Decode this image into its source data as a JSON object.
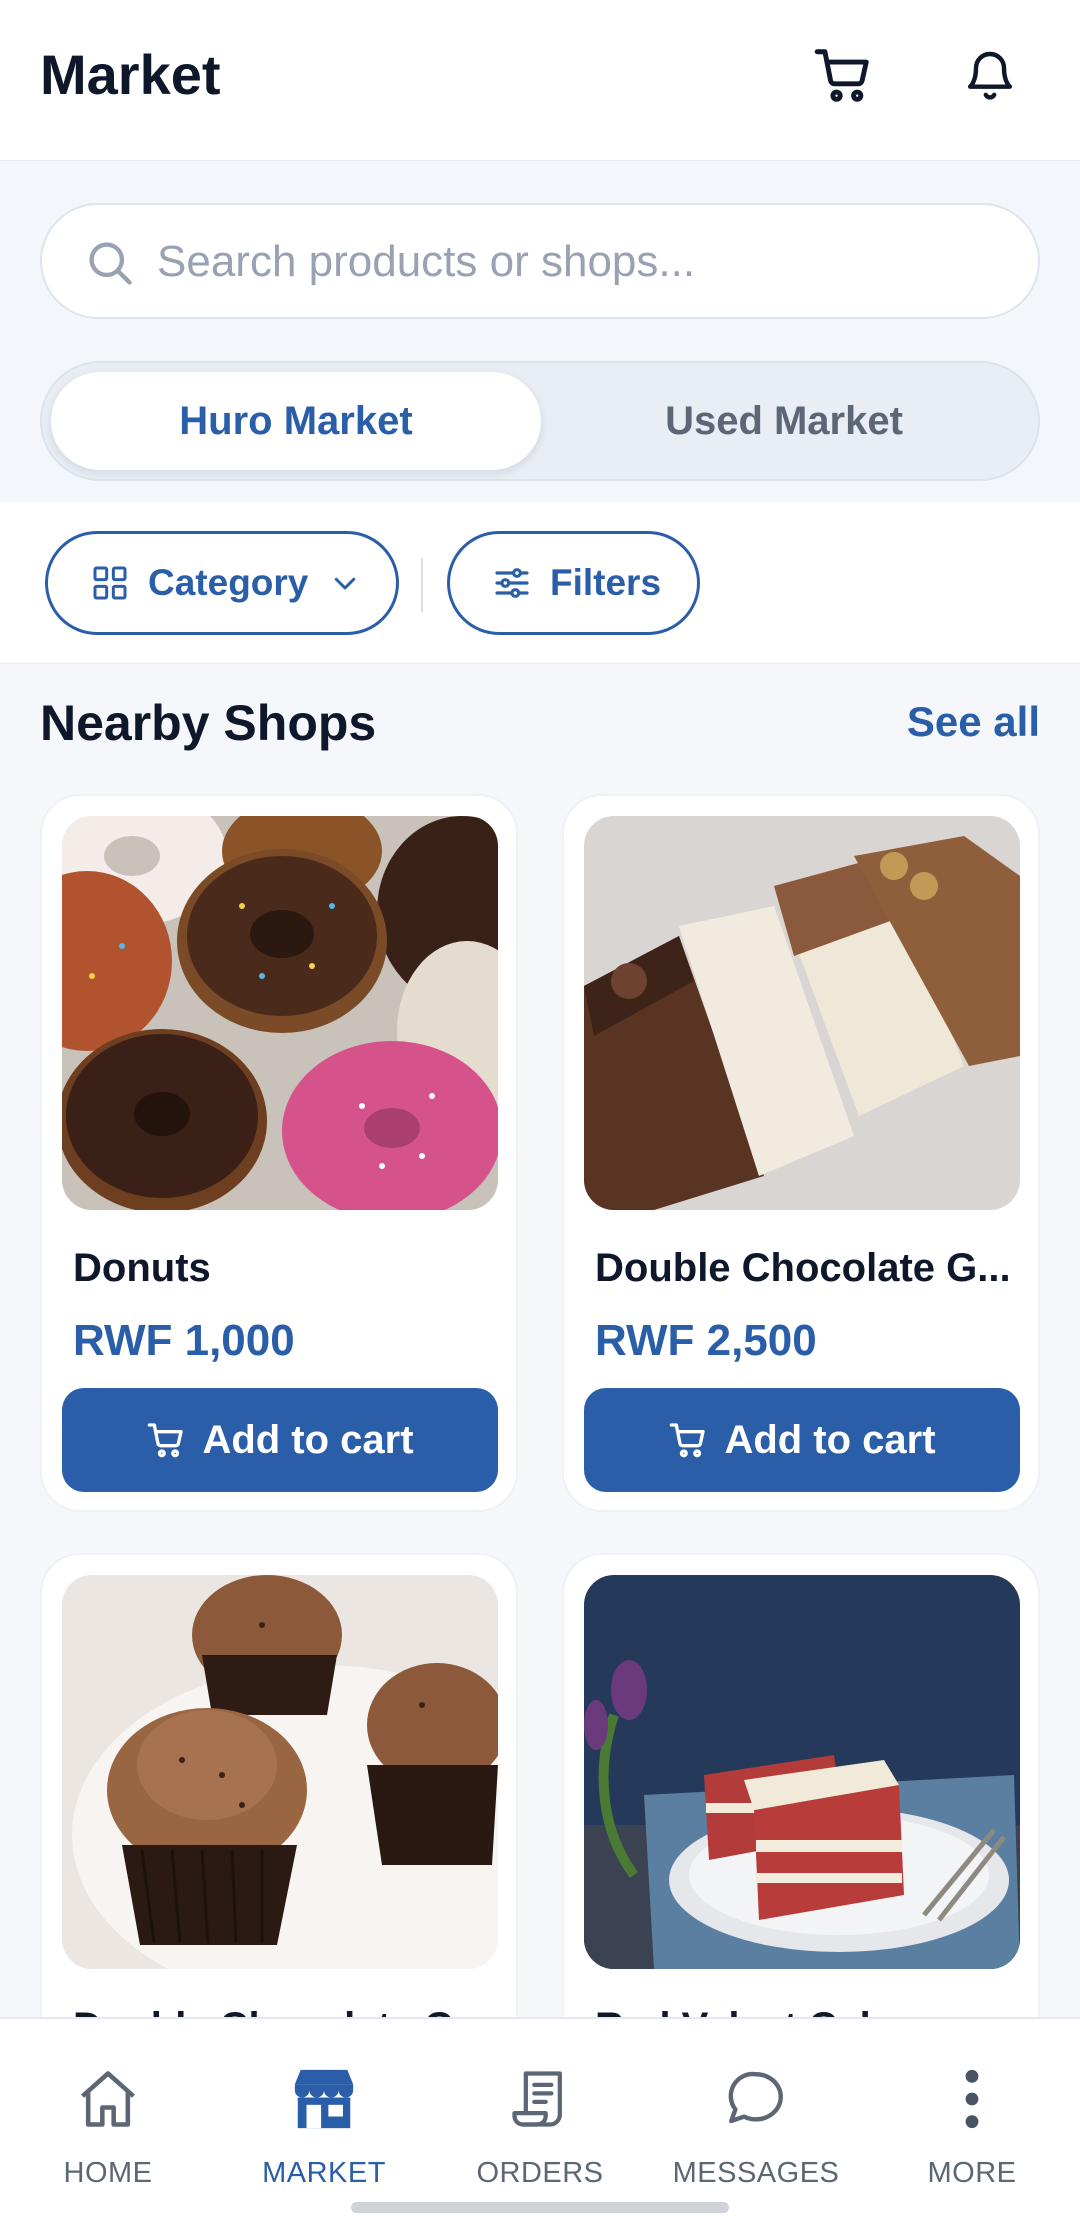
{
  "header": {
    "title": "Market",
    "icons": [
      "cart-icon",
      "bell-icon"
    ]
  },
  "search": {
    "placeholder": "Search products or shops...",
    "value": ""
  },
  "market_toggle": {
    "options": [
      "Huro Market",
      "Used Market"
    ],
    "selected": "Huro Market"
  },
  "filters": {
    "category_label": "Category",
    "filters_label": "Filters"
  },
  "section": {
    "title": "Nearby Shops",
    "see_all": "See all"
  },
  "products": [
    {
      "name": "Donuts",
      "price": "RWF 1,000",
      "button": "Add to cart"
    },
    {
      "name": "Double Chocolate G...",
      "price": "RWF 2,500",
      "button": "Add to cart"
    },
    {
      "name": "Double Chocolate C...",
      "price": "",
      "button": ""
    },
    {
      "name": "Red Velvet Cake",
      "price": "",
      "button": ""
    }
  ],
  "bottom_nav": [
    {
      "label": "HOME",
      "icon": "home-icon",
      "active": false
    },
    {
      "label": "MARKET",
      "icon": "shop-icon",
      "active": true
    },
    {
      "label": "ORDERS",
      "icon": "orders-icon",
      "active": false
    },
    {
      "label": "MESSAGES",
      "icon": "chat-icon",
      "active": false
    },
    {
      "label": "MORE",
      "icon": "more-icon",
      "active": false
    }
  ],
  "colors": {
    "accent": "#2a5ea8",
    "text": "#0f172a",
    "muted": "#5c6675"
  }
}
